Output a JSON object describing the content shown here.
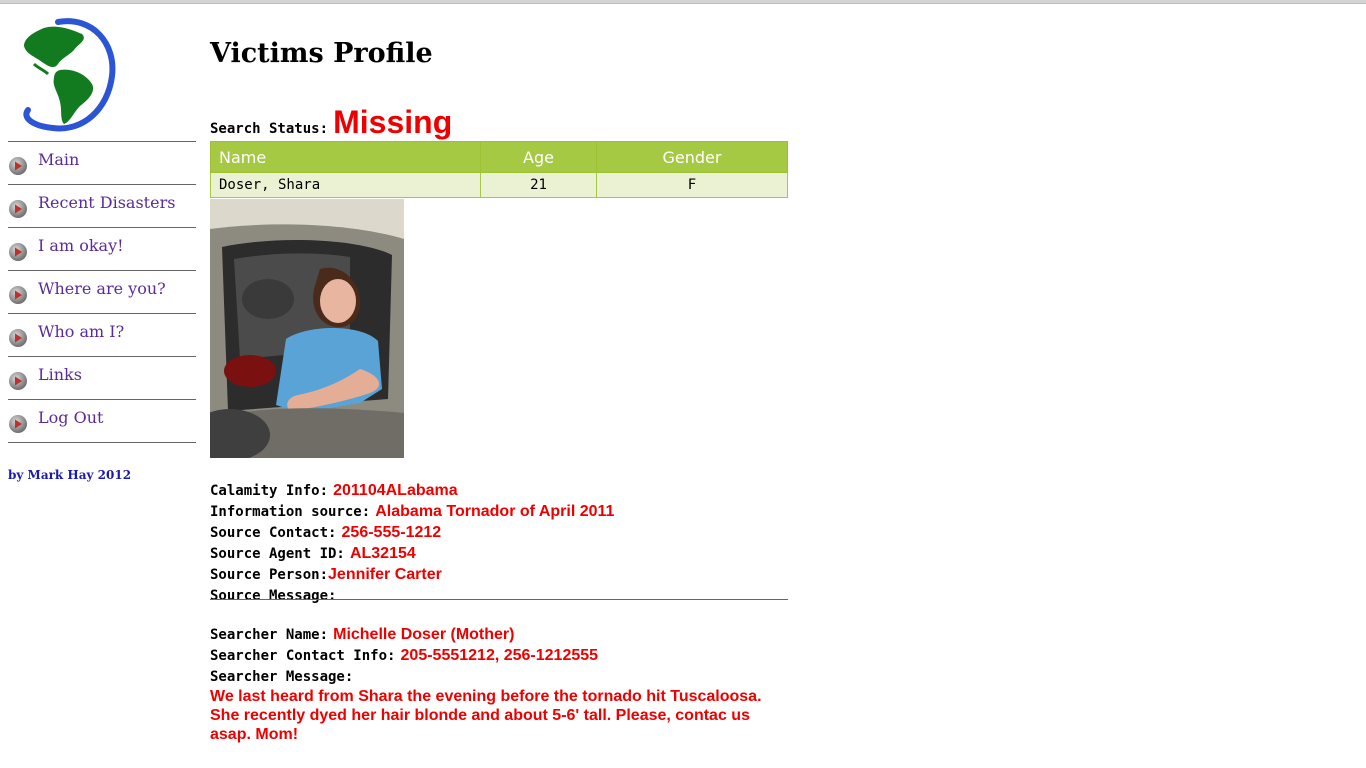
{
  "sidebar": {
    "logo_icon": "globe-icon",
    "nav": [
      {
        "label": "Main"
      },
      {
        "label": "Recent Disasters"
      },
      {
        "label": "I am okay!"
      },
      {
        "label": "Where are you?"
      },
      {
        "label": "Who am I?"
      },
      {
        "label": "Links"
      },
      {
        "label": "Log Out"
      }
    ],
    "credit": "by Mark Hay 2012"
  },
  "main": {
    "title": "Victims Profile",
    "search_status_label": "Search Status:",
    "search_status_value": "Missing",
    "table": {
      "headers": [
        "Name",
        "Age",
        "Gender"
      ],
      "rows": [
        {
          "name": "Doser, Shara",
          "age": "21",
          "gender": "F"
        }
      ]
    },
    "info": {
      "calamity_label": "Calamity Info:",
      "calamity_value": "201104ALabama",
      "source_label": "Information source:",
      "source_value": "Alabama Tornador of April 2011",
      "contact_label": "Source Contact:",
      "contact_value": "256-555-1212",
      "agent_label": "Source Agent ID:",
      "agent_value": "AL32154",
      "person_label": "Source Person:",
      "person_value": "Jennifer Carter",
      "message_label": "Source Message:"
    },
    "searcher": {
      "name_label": "Searcher Name:",
      "name_value": "Michelle Doser (Mother)",
      "contact_label": "Searcher Contact Info:",
      "contact_value": "205-5551212, 256-1212555",
      "message_label": "Searcher Message:",
      "message_value": "We last heard from Shara the evening before the tornado hit Tuscaloosa. She recently dyed her hair blonde and about 5-6' tall. Please, contac us asap. Mom!"
    }
  },
  "colors": {
    "accent_red": "#ee0000",
    "table_header": "#a6c943",
    "table_row": "#eaf2d3",
    "nav_link": "#5a2a9a",
    "credit": "#1a1ab0"
  }
}
